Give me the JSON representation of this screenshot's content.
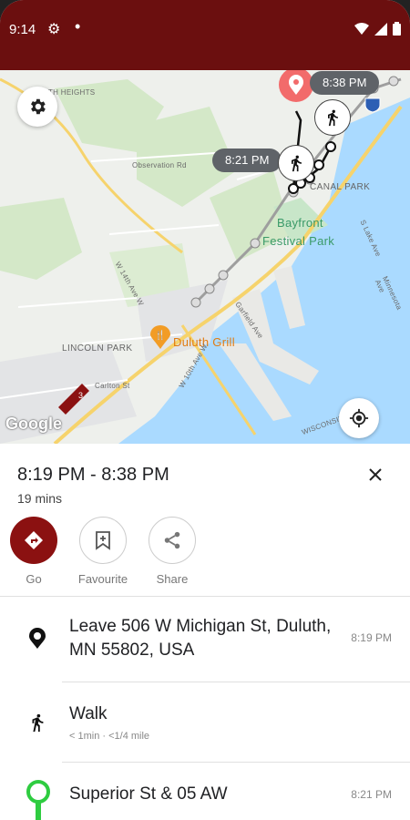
{
  "status_bar": {
    "time": "9:14"
  },
  "map": {
    "labels": {
      "heights": "DULUTH HEIGHTS",
      "observation": "Observation Rd",
      "canal_park": "CANAL PARK",
      "bayfront": "Bayfront",
      "festival_park": "Festival Park",
      "lincoln_park": "LINCOLN PARK",
      "duluth_grill": "Duluth Grill",
      "ave_14": "W 14th Ave W",
      "carlton": "Carlton St",
      "garfield": "Garfield Ave",
      "ave_10": "W 10th Ave W",
      "minnesota": "Minnesota Ave",
      "lake": "S Lake Ave",
      "wisconsin": "WISCONSIN",
      "bus_number": "3"
    },
    "arrival_time": "8:38 PM",
    "departure_time": "8:21 PM",
    "google_logo": "Google"
  },
  "trip": {
    "time_range": "8:19 PM - 8:38 PM",
    "duration": "19 mins"
  },
  "actions": [
    {
      "label": "Go"
    },
    {
      "label": "Favourite"
    },
    {
      "label": "Share"
    }
  ],
  "steps": [
    {
      "title": "Leave 506 W Michigan St, Duluth, MN 55802, USA",
      "time": "8:19 PM"
    },
    {
      "title": "Walk",
      "subtitle": "< 1min · <1/4 mile"
    },
    {
      "title": "Superior St & 05 AW",
      "time": "8:21 PM"
    }
  ],
  "colors": {
    "brand": "#6b0f0f",
    "accent": "#8b1111",
    "water": "#aadaff",
    "park": "#c8e6c9"
  }
}
